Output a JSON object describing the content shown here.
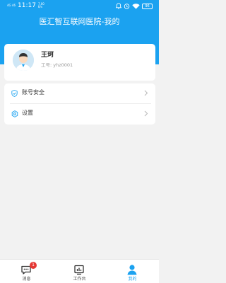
{
  "status_bar": {
    "network": "4G 46",
    "time": "11:17",
    "speed": "7.00 K/s",
    "battery": "96"
  },
  "header": {
    "title": "医汇智互联网医院-我的"
  },
  "profile": {
    "name": "王珂",
    "employee_no": "工号: yhz0001"
  },
  "menu": [
    {
      "label": "账号安全",
      "icon": "shield-icon"
    },
    {
      "label": "设置",
      "icon": "gear-icon"
    }
  ],
  "tabbar": {
    "tabs": [
      {
        "label": "消息",
        "icon": "message-icon",
        "badge": "1"
      },
      {
        "label": "工作台",
        "icon": "workbench-icon"
      },
      {
        "label": "我的",
        "icon": "person-icon",
        "active": true
      }
    ]
  },
  "colors": {
    "primary": "#1ba2f0",
    "badge": "#e53935",
    "background": "#f2f2f2"
  }
}
